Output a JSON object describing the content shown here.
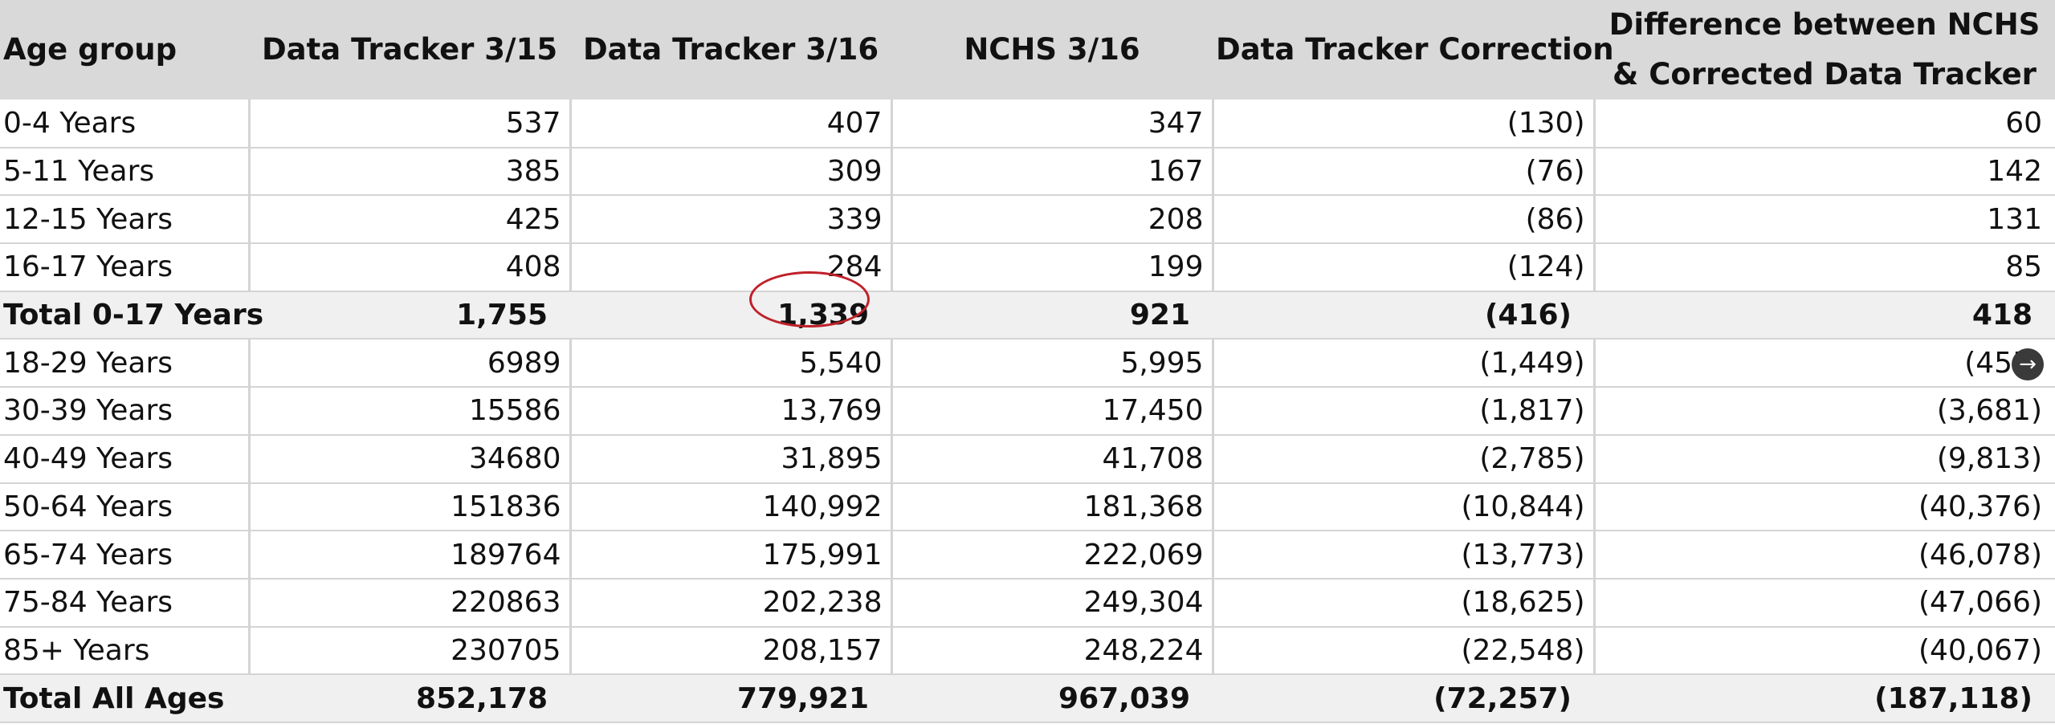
{
  "table": {
    "headers": [
      "Age group",
      "Data Tracker 3/15",
      "Data Tracker 3/16",
      "NCHS 3/16",
      "Data Tracker Correction",
      "Difference between NCHS & Corrected Data Tracker"
    ],
    "rows": [
      [
        "0-4 Years",
        "537",
        "407",
        "347",
        "(130)",
        "60"
      ],
      [
        "5-11 Years",
        "385",
        "309",
        "167",
        "(76)",
        "142"
      ],
      [
        "12-15 Years",
        "425",
        "339",
        "208",
        "(86)",
        "131"
      ],
      [
        "16-17 Years",
        "408",
        "284",
        "199",
        "(124)",
        "85"
      ],
      [
        "Total 0-17 Years",
        "1,755",
        "1,339",
        "921",
        "(416)",
        "418"
      ],
      [
        "18-29 Years",
        "6989",
        "5,540",
        "5,995",
        "(1,449)",
        "(455)"
      ],
      [
        "30-39 Years",
        "15586",
        "13,769",
        "17,450",
        "(1,817)",
        "(3,681)"
      ],
      [
        "40-49 Years",
        "34680",
        "31,895",
        "41,708",
        "(2,785)",
        "(9,813)"
      ],
      [
        "50-64 Years",
        "151836",
        "140,992",
        "181,368",
        "(10,844)",
        "(40,376)"
      ],
      [
        "65-74 Years",
        "189764",
        "175,991",
        "222,069",
        "(13,773)",
        "(46,078)"
      ],
      [
        "75-84 Years",
        "220863",
        "202,238",
        "249,304",
        "(18,625)",
        "(47,066)"
      ],
      [
        "85+ Years",
        "230705",
        "208,157",
        "248,224",
        "(22,548)",
        "(40,067)"
      ],
      [
        "Total All Ages",
        "852,178",
        "779,921",
        "967,039",
        "(72,257)",
        "(187,118)"
      ]
    ]
  },
  "icons": {
    "overlay_arrow": "arrow-right-icon"
  }
}
